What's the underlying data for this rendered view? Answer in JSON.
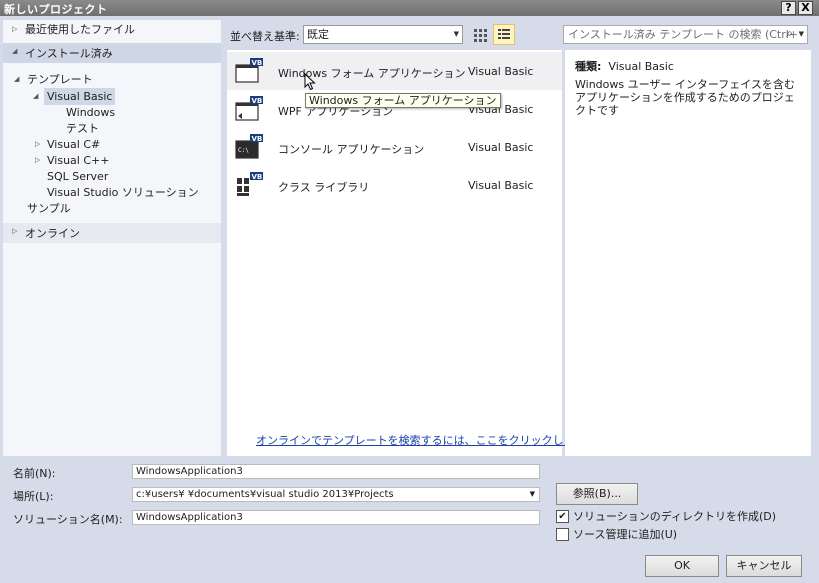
{
  "window": {
    "title": "新しいプロジェクト",
    "help_btn": "?",
    "close_btn": "X"
  },
  "tree": {
    "recent": "最近使用したファイル",
    "installed": "インストール済み",
    "templates": "テンプレート",
    "vb": "Visual Basic",
    "windows": "Windows",
    "test": "テスト",
    "csharp": "Visual C#",
    "cpp": "Visual C++",
    "sql": "SQL Server",
    "vs_solution": "Visual Studio ソリューション",
    "sample": "サンプル",
    "online": "オンライン"
  },
  "toolbar": {
    "sort_label": "並べ替え基準:",
    "sort_value": "既定",
    "search_placeholder": "インストール済み テンプレート の検索 (Ctrl+"
  },
  "templates": [
    {
      "name": "Windows フォーム アプリケーション",
      "lang": "Visual Basic",
      "icon": "windows-form-icon"
    },
    {
      "name": "WPF アプリケーション",
      "lang": "Visual Basic",
      "icon": "wpf-app-icon"
    },
    {
      "name": "コンソール アプリケーション",
      "lang": "Visual Basic",
      "icon": "console-app-icon"
    },
    {
      "name": "クラス ライブラリ",
      "lang": "Visual Basic",
      "icon": "class-library-icon"
    }
  ],
  "tooltip": "Windows フォーム アプリケーション",
  "online_link": "オンラインでテンプレートを検索するには、ここをクリックします。",
  "details": {
    "kind_label": "種類:",
    "kind_value": "Visual Basic",
    "description": "Windows ユーザー インターフェイスを含むアプリケーションを作成するためのプロジェクトです"
  },
  "form": {
    "name_label": "名前(N):",
    "name_value": "WindowsApplication3",
    "location_label": "場所(L):",
    "location_value": "c:¥users¥          ¥documents¥visual studio 2013¥Projects",
    "solution_label": "ソリューション名(M):",
    "solution_value": "WindowsApplication3",
    "browse_btn": "参照(B)...",
    "create_dir_label": "ソリューションのディレクトリを作成(D)",
    "create_dir_checked": true,
    "source_control_label": "ソース管理に追加(U)",
    "source_control_checked": false,
    "ok_btn": "OK",
    "cancel_btn": "キャンセル"
  },
  "colors": {
    "accent_blue": "#1a41a8",
    "vb_badge": "#1c3c7c",
    "selection": "#cfd6e5",
    "background": "#d6dbe9"
  }
}
